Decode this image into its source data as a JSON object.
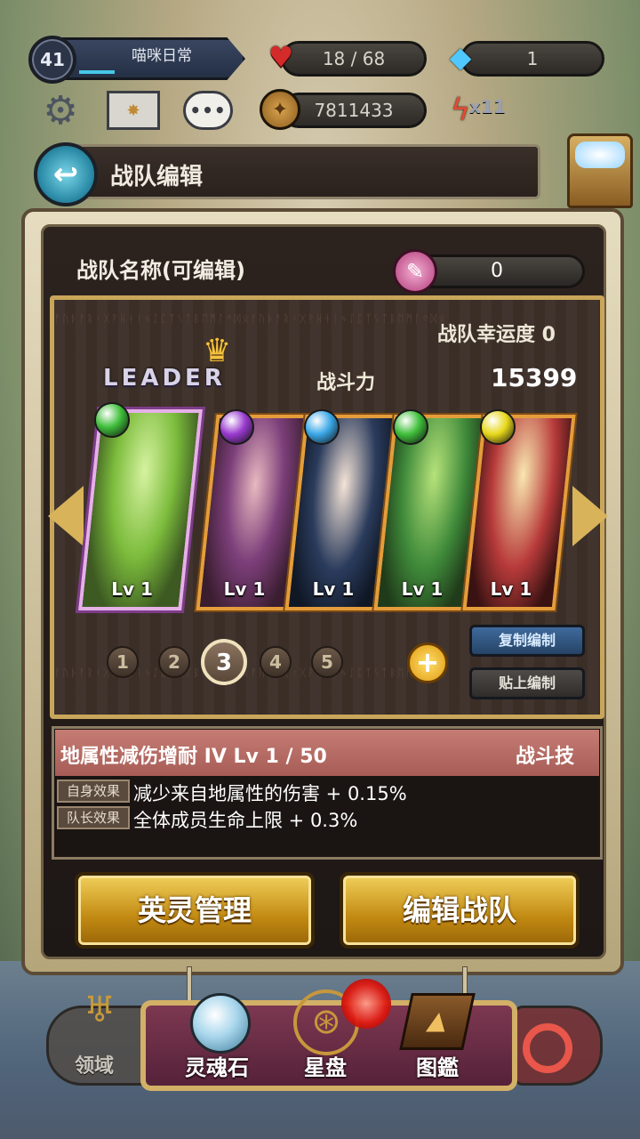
{
  "status": {
    "level": "41",
    "player_name": "喵咪日常",
    "hearts": "18 / 68",
    "gems": "1",
    "coins": "7811433",
    "energy": "x11"
  },
  "title": "战队编辑",
  "team": {
    "name": "战队名称(可编辑)",
    "ticket_count": "0",
    "luck": "战队幸运度 0",
    "leader_label": "LEADER",
    "power_label": "战斗力",
    "power_value": "15399",
    "cards": [
      {
        "level": "Lv 1",
        "element": "green",
        "color": "#3fbf3a"
      },
      {
        "level": "Lv 1",
        "element": "purple",
        "color": "#9a3ad0"
      },
      {
        "level": "Lv 1",
        "element": "blue",
        "color": "#3aa8e8"
      },
      {
        "level": "Lv 1",
        "element": "green",
        "color": "#3fbf3a"
      },
      {
        "level": "Lv 1",
        "element": "yellow",
        "color": "#e8d81a"
      }
    ],
    "pages": [
      "1",
      "2",
      "3",
      "4",
      "5"
    ],
    "active_page": "3",
    "copy_label": "复制编制",
    "paste_label": "贴上编制"
  },
  "skill": {
    "name": "地属性减伤增耐 IV  Lv  1 / 50",
    "type": "战斗技",
    "self_tag": "自身效果",
    "self_effect": "减少来自地属性的伤害 + 0.15%",
    "leader_tag": "队长效果",
    "leader_effect": "全体成员生命上限 + 0.3%"
  },
  "buttons": {
    "hero_manage": "英灵管理",
    "edit_team": "编辑战队"
  },
  "nav": {
    "domain": "领域",
    "soul_stone": "灵魂石",
    "astrolabe": "星盘",
    "codex": "图鑑"
  }
}
